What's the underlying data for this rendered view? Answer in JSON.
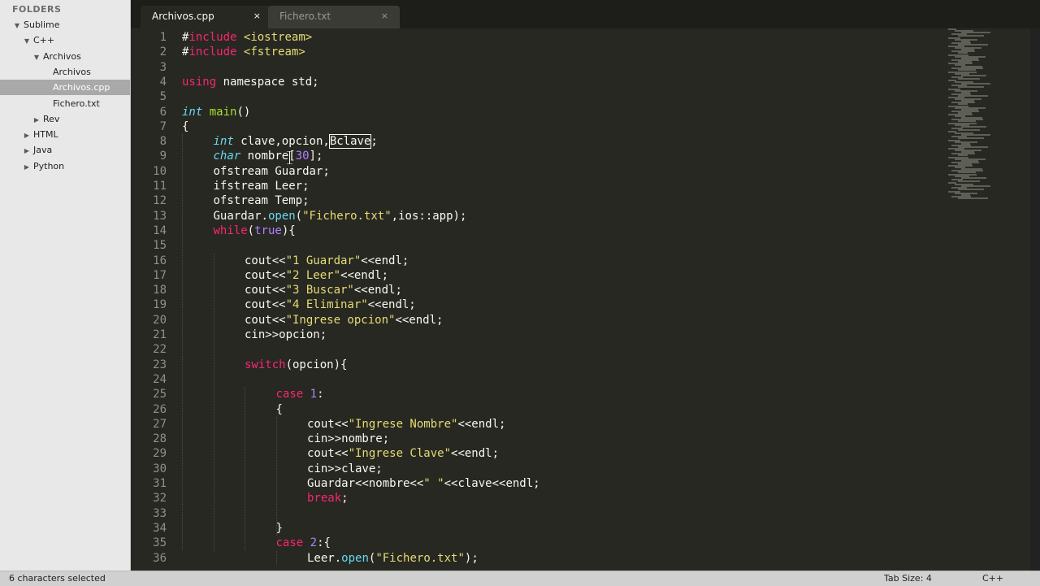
{
  "sidebar": {
    "header": "FOLDERS",
    "tree": [
      {
        "label": "Sublime",
        "indent": 0,
        "disclosure": "open",
        "selected": false
      },
      {
        "label": "C++",
        "indent": 1,
        "disclosure": "open",
        "selected": false
      },
      {
        "label": "Archivos",
        "indent": 2,
        "disclosure": "open",
        "selected": false
      },
      {
        "label": "Archivos",
        "indent": 3,
        "disclosure": "none",
        "selected": false
      },
      {
        "label": "Archivos.cpp",
        "indent": 3,
        "disclosure": "none",
        "selected": true
      },
      {
        "label": "Fichero.txt",
        "indent": 3,
        "disclosure": "none",
        "selected": false
      },
      {
        "label": "Rev",
        "indent": 2,
        "disclosure": "closed",
        "selected": false
      },
      {
        "label": "HTML",
        "indent": 1,
        "disclosure": "closed",
        "selected": false
      },
      {
        "label": "Java",
        "indent": 1,
        "disclosure": "closed",
        "selected": false
      },
      {
        "label": "Python",
        "indent": 1,
        "disclosure": "closed",
        "selected": false
      }
    ]
  },
  "tabs": [
    {
      "label": "Archivos.cpp",
      "active": true,
      "close": "×"
    },
    {
      "label": "Fichero.txt",
      "active": false,
      "close": "×"
    }
  ],
  "colors": {
    "background": "#272822",
    "text": "#f8f8f2",
    "keyword": "#f92672",
    "type": "#66d9ef",
    "string": "#e6db74",
    "number": "#ae81ff",
    "function": "#a6e22e",
    "comment_gutter": "#90908a"
  },
  "editor": {
    "selected_word": "Bclave",
    "lines": [
      {
        "n": "1",
        "indent": 0,
        "tokens": [
          [
            "#",
            "t"
          ],
          [
            "include",
            "k"
          ],
          [
            " ",
            "t"
          ],
          [
            "<iostream>",
            "s"
          ]
        ]
      },
      {
        "n": "2",
        "indent": 0,
        "tokens": [
          [
            "#",
            "t"
          ],
          [
            "include",
            "k"
          ],
          [
            " ",
            "t"
          ],
          [
            "<fstream>",
            "s"
          ]
        ]
      },
      {
        "n": "3",
        "indent": 0,
        "tokens": []
      },
      {
        "n": "4",
        "indent": 0,
        "tokens": [
          [
            "using",
            "k"
          ],
          [
            " namespace std;",
            "t"
          ]
        ]
      },
      {
        "n": "5",
        "indent": 0,
        "tokens": []
      },
      {
        "n": "6",
        "indent": 0,
        "tokens": [
          [
            "int",
            "ty"
          ],
          [
            " ",
            "t"
          ],
          [
            "main",
            "f"
          ],
          [
            "()",
            "t"
          ]
        ]
      },
      {
        "n": "7",
        "indent": 0,
        "tokens": [
          [
            "{",
            "t"
          ]
        ]
      },
      {
        "n": "8",
        "indent": 1,
        "tokens": [
          [
            "int",
            "ty"
          ],
          [
            " clave,opcion,",
            "t"
          ],
          [
            "Bclave",
            "sel"
          ],
          [
            ";",
            "t"
          ]
        ]
      },
      {
        "n": "9",
        "indent": 1,
        "tokens": [
          [
            "char",
            "ty"
          ],
          [
            " nombre[",
            "t"
          ],
          [
            "30",
            "n"
          ],
          [
            "];",
            "t"
          ]
        ]
      },
      {
        "n": "10",
        "indent": 1,
        "tokens": [
          [
            "ofstream Guardar;",
            "t"
          ]
        ]
      },
      {
        "n": "11",
        "indent": 1,
        "tokens": [
          [
            "ifstream Leer;",
            "t"
          ]
        ]
      },
      {
        "n": "12",
        "indent": 1,
        "tokens": [
          [
            "ofstream Temp;",
            "t"
          ]
        ]
      },
      {
        "n": "13",
        "indent": 1,
        "tokens": [
          [
            "Guardar.",
            "t"
          ],
          [
            "open",
            "ty"
          ],
          [
            "(",
            "t"
          ],
          [
            "\"Fichero.txt\"",
            "s"
          ],
          [
            ",ios::app);",
            "t"
          ]
        ]
      },
      {
        "n": "14",
        "indent": 1,
        "tokens": [
          [
            "while",
            "k"
          ],
          [
            "(",
            "t"
          ],
          [
            "true",
            "n"
          ],
          [
            "){",
            "t"
          ]
        ]
      },
      {
        "n": "15",
        "indent": 0,
        "tokens": []
      },
      {
        "n": "16",
        "indent": 2,
        "tokens": [
          [
            "cout<<",
            "t"
          ],
          [
            "\"1 Guardar\"",
            "s"
          ],
          [
            "<<endl;",
            "t"
          ]
        ]
      },
      {
        "n": "17",
        "indent": 2,
        "tokens": [
          [
            "cout<<",
            "t"
          ],
          [
            "\"2 Leer\"",
            "s"
          ],
          [
            "<<endl;",
            "t"
          ]
        ]
      },
      {
        "n": "18",
        "indent": 2,
        "tokens": [
          [
            "cout<<",
            "t"
          ],
          [
            "\"3 Buscar\"",
            "s"
          ],
          [
            "<<endl;",
            "t"
          ]
        ]
      },
      {
        "n": "19",
        "indent": 2,
        "tokens": [
          [
            "cout<<",
            "t"
          ],
          [
            "\"4 Eliminar\"",
            "s"
          ],
          [
            "<<endl;",
            "t"
          ]
        ]
      },
      {
        "n": "20",
        "indent": 2,
        "tokens": [
          [
            "cout<<",
            "t"
          ],
          [
            "\"Ingrese opcion\"",
            "s"
          ],
          [
            "<<endl;",
            "t"
          ]
        ]
      },
      {
        "n": "21",
        "indent": 2,
        "tokens": [
          [
            "cin>>opcion;",
            "t"
          ]
        ]
      },
      {
        "n": "22",
        "indent": 0,
        "tokens": []
      },
      {
        "n": "23",
        "indent": 2,
        "tokens": [
          [
            "switch",
            "k"
          ],
          [
            "(opcion){",
            "t"
          ]
        ]
      },
      {
        "n": "24",
        "indent": 0,
        "tokens": []
      },
      {
        "n": "25",
        "indent": 3,
        "tokens": [
          [
            "case",
            "k"
          ],
          [
            " ",
            "t"
          ],
          [
            "1",
            "n"
          ],
          [
            ":",
            "t"
          ]
        ]
      },
      {
        "n": "26",
        "indent": 3,
        "tokens": [
          [
            "{",
            "t"
          ]
        ]
      },
      {
        "n": "27",
        "indent": 4,
        "tokens": [
          [
            "cout<<",
            "t"
          ],
          [
            "\"Ingrese Nombre\"",
            "s"
          ],
          [
            "<<endl;",
            "t"
          ]
        ]
      },
      {
        "n": "28",
        "indent": 4,
        "tokens": [
          [
            "cin>>nombre;",
            "t"
          ]
        ]
      },
      {
        "n": "29",
        "indent": 4,
        "tokens": [
          [
            "cout<<",
            "t"
          ],
          [
            "\"Ingrese Clave\"",
            "s"
          ],
          [
            "<<endl;",
            "t"
          ]
        ]
      },
      {
        "n": "30",
        "indent": 4,
        "tokens": [
          [
            "cin>>clave;",
            "t"
          ]
        ]
      },
      {
        "n": "31",
        "indent": 4,
        "tokens": [
          [
            "Guardar<<nombre<<",
            "t"
          ],
          [
            "\" \"",
            "s"
          ],
          [
            "<<clave<<endl;",
            "t"
          ]
        ]
      },
      {
        "n": "32",
        "indent": 4,
        "tokens": [
          [
            "break",
            "k"
          ],
          [
            ";",
            "t"
          ]
        ]
      },
      {
        "n": "33",
        "indent": 0,
        "tokens": []
      },
      {
        "n": "34",
        "indent": 3,
        "tokens": [
          [
            "}",
            "t"
          ]
        ]
      },
      {
        "n": "35",
        "indent": 3,
        "tokens": [
          [
            "case",
            "k"
          ],
          [
            " ",
            "t"
          ],
          [
            "2",
            "n"
          ],
          [
            ":{",
            "t"
          ]
        ]
      },
      {
        "n": "36",
        "indent": 4,
        "tokens": [
          [
            "Leer.",
            "t"
          ],
          [
            "open",
            "ty"
          ],
          [
            "(",
            "t"
          ],
          [
            "\"Fichero.txt\"",
            "s"
          ],
          [
            ");",
            "t"
          ]
        ]
      }
    ]
  },
  "status": {
    "left": "6 characters selected",
    "tab_size": "Tab Size: 4",
    "syntax": "C++"
  }
}
